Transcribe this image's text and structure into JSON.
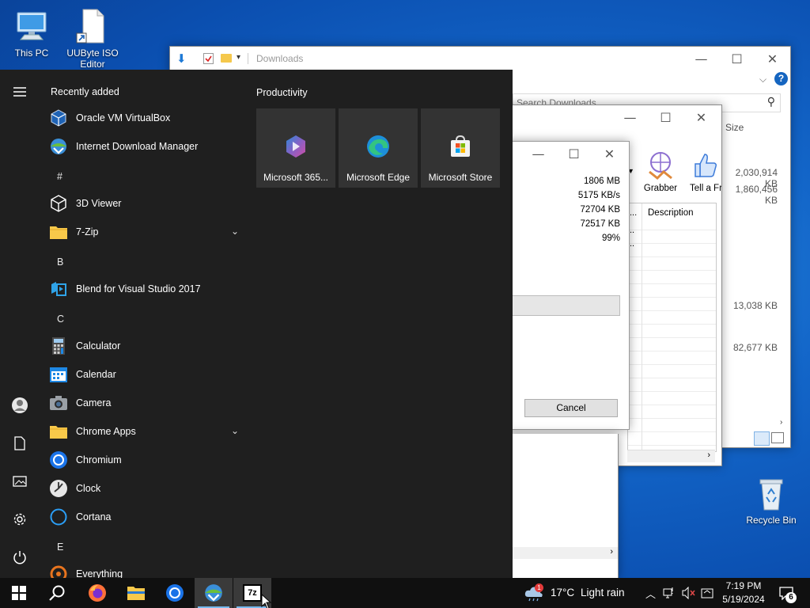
{
  "desktop": {
    "icons": [
      {
        "label": "This PC"
      },
      {
        "label": "UUByte ISO Editor"
      },
      {
        "label": "Recycle Bin"
      }
    ]
  },
  "explorer": {
    "title": "Downloads",
    "search_placeholder": "Search Downloads",
    "column_size": "Size",
    "sizes": [
      "2,030,914 KB",
      "1,860,456 KB",
      "13,038 KB",
      "82,677 KB"
    ]
  },
  "archive_window": {
    "toolbar": [
      {
        "label": "Grabber"
      },
      {
        "label": "Tell a Fri"
      }
    ],
    "column_description": "Description"
  },
  "progress_dialog": {
    "values": [
      "1806 MB",
      "5175 KB/s",
      "72704 KB",
      "72517 KB",
      "99%"
    ],
    "progress": 0.99,
    "cancel_label": "Cancel"
  },
  "start_menu": {
    "recently_added_label": "Recently added",
    "productivity_label": "Productivity",
    "recent": [
      {
        "label": "Oracle VM VirtualBox",
        "icon": "virtualbox-icon"
      },
      {
        "label": "Internet Download Manager",
        "icon": "idm-icon"
      }
    ],
    "groups": [
      {
        "letter": "#",
        "items": [
          {
            "label": "3D Viewer",
            "icon": "cube-icon"
          },
          {
            "label": "7-Zip",
            "icon": "folder-icon",
            "expandable": true
          }
        ]
      },
      {
        "letter": "B",
        "items": [
          {
            "label": "Blend for Visual Studio 2017",
            "icon": "blend-icon"
          }
        ]
      },
      {
        "letter": "C",
        "items": [
          {
            "label": "Calculator",
            "icon": "calculator-icon"
          },
          {
            "label": "Calendar",
            "icon": "calendar-icon"
          },
          {
            "label": "Camera",
            "icon": "camera-icon"
          },
          {
            "label": "Chrome Apps",
            "icon": "folder-icon",
            "expandable": true
          },
          {
            "label": "Chromium",
            "icon": "chromium-icon"
          },
          {
            "label": "Clock",
            "icon": "clock-icon"
          },
          {
            "label": "Cortana",
            "icon": "cortana-icon"
          }
        ]
      },
      {
        "letter": "E",
        "items": [
          {
            "label": "Everything",
            "icon": "everything-icon"
          }
        ]
      }
    ],
    "tiles": [
      {
        "label": "Microsoft 365...",
        "icon": "microsoft-365-icon"
      },
      {
        "label": "Microsoft Edge",
        "icon": "edge-icon"
      },
      {
        "label": "Microsoft Store",
        "icon": "store-icon"
      }
    ]
  },
  "taskbar": {
    "weather_temp": "17°C",
    "weather_desc": "Light rain",
    "weather_badge": "1",
    "time": "7:19 PM",
    "date": "5/19/2024",
    "notification_count": "6"
  },
  "colors": {
    "accent": "#0078d7",
    "taskbar_bg": "#101010",
    "start_bg": "#1f1f1f",
    "tile_bg": "#333333"
  }
}
